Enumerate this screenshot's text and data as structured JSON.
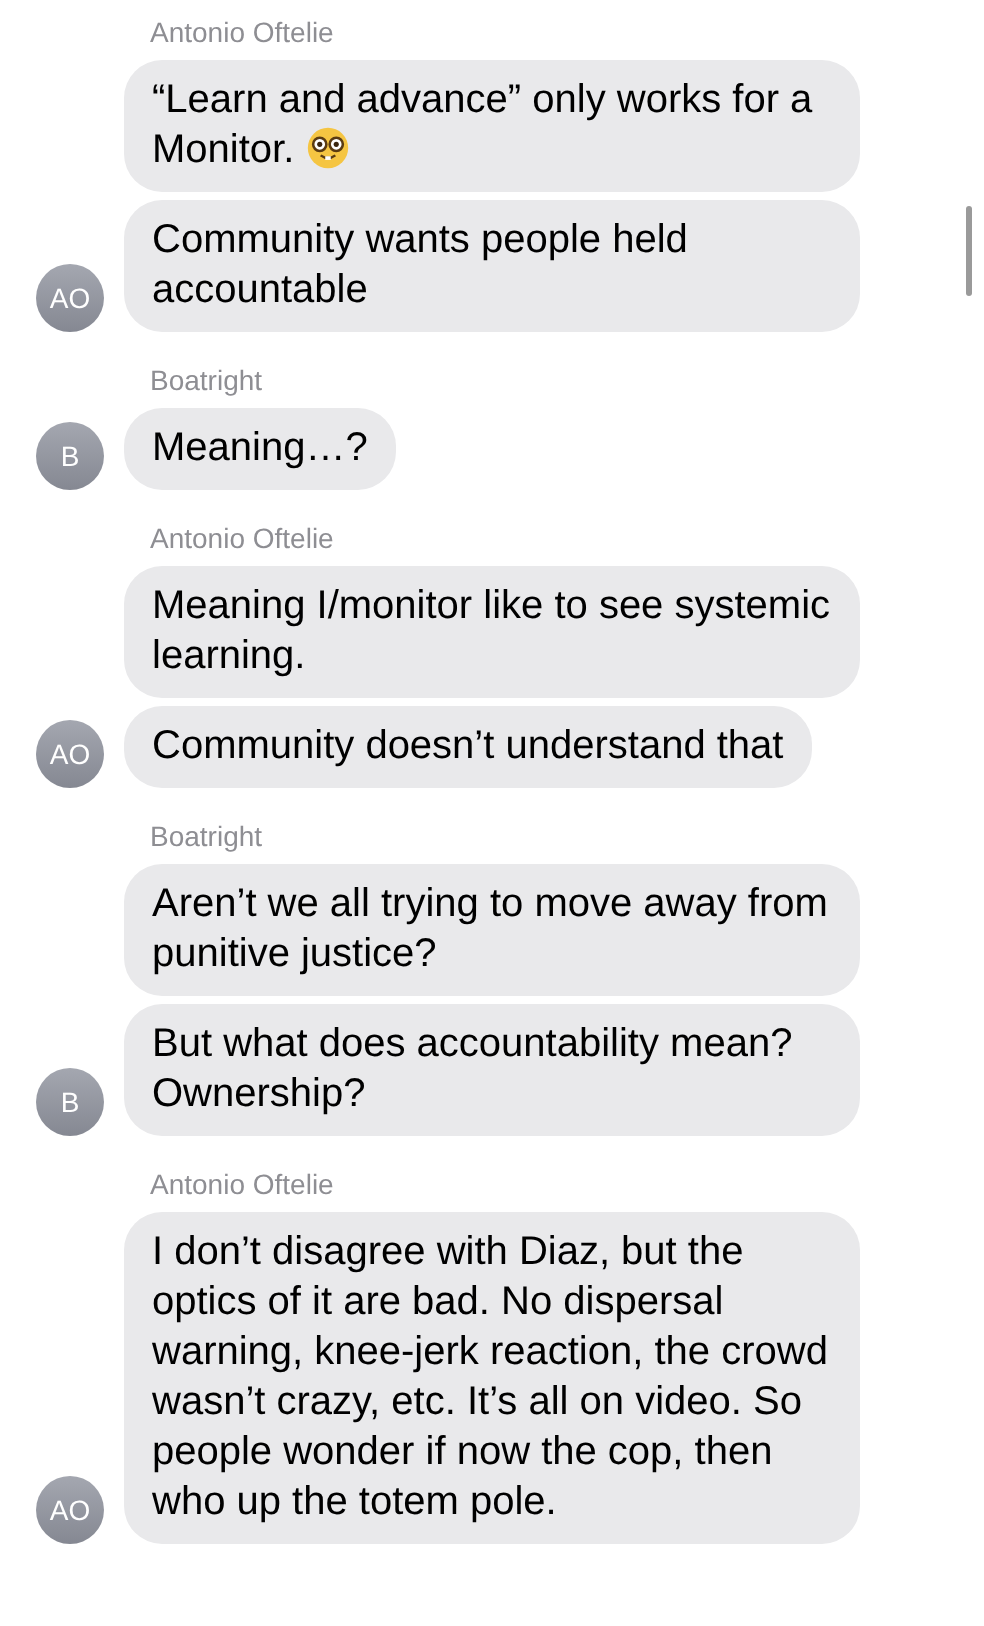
{
  "groups": [
    {
      "sender": "Antonio Oftelie",
      "initials": "AO",
      "messages": [
        {
          "kind": "text_with_emoji",
          "text": "“Learn and advance” only works for a Monitor."
        },
        {
          "kind": "text",
          "text": "Community wants people held accountable"
        }
      ]
    },
    {
      "sender": "Boatright",
      "initials": "B",
      "messages": [
        {
          "kind": "text",
          "text": "Meaning…?"
        }
      ]
    },
    {
      "sender": "Antonio Oftelie",
      "initials": "AO",
      "messages": [
        {
          "kind": "text",
          "text": "Meaning I/monitor like to see systemic learning."
        },
        {
          "kind": "text",
          "text": "Community doesn’t understand that"
        }
      ]
    },
    {
      "sender": "Boatright",
      "initials": "B",
      "messages": [
        {
          "kind": "text",
          "text": "Aren’t we all trying to move away from punitive justice?"
        },
        {
          "kind": "text",
          "text": "But what does accountability mean?  Ownership?"
        }
      ]
    },
    {
      "sender": "Antonio Oftelie",
      "initials": "AO",
      "messages": [
        {
          "kind": "text",
          "text": "I don’t disagree with Diaz, but the optics of it are bad. No dispersal warning, knee-jerk reaction, the crowd wasn’t crazy, etc. It’s all on video. So people wonder if now the cop, then who up the totem pole."
        }
      ]
    }
  ]
}
